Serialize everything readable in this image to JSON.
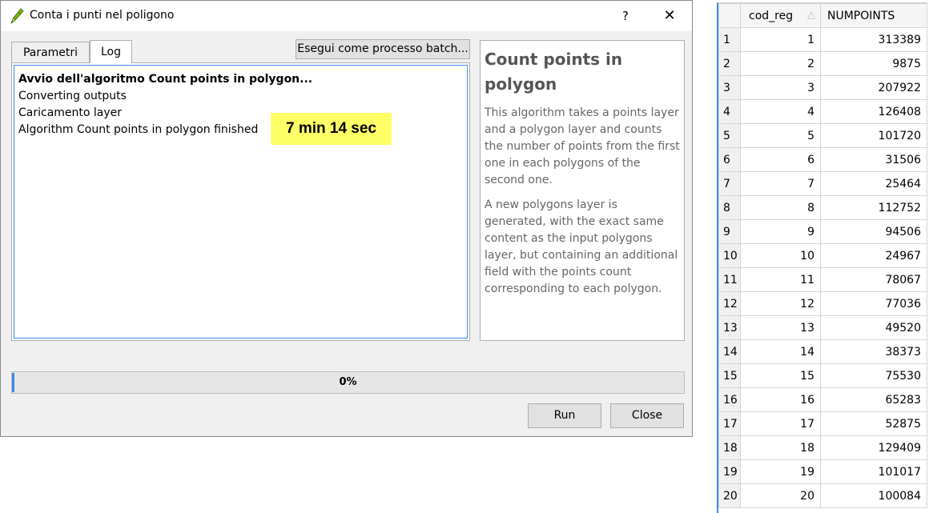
{
  "dialog": {
    "title": "Conta i punti nel poligono",
    "help_label": "?",
    "close_label": "✕",
    "tabs": [
      {
        "label": "Parametri",
        "active": false
      },
      {
        "label": "Log",
        "active": true
      }
    ],
    "batch_button": "Esegui come processo batch...",
    "log_lines": [
      "Avvio dell'algoritmo Count points in polygon...",
      "Converting outputs",
      "Caricamento layer",
      "Algorithm Count points in polygon finished"
    ],
    "time_badge": "7 min 14 sec",
    "help_title": "Count points in polygon",
    "help_paragraphs": [
      "This algorithm takes a points layer and a polygon layer and counts the number of points from the first one in each polygons of the second one.",
      "A new polygons layer is generated, with the exact same content as the input polygons layer, but containing an additional field with the points count corresponding to each polygon."
    ],
    "progress": {
      "text": "0%",
      "value": 0
    },
    "run_button": "Run",
    "close_button": "Close"
  },
  "table": {
    "columns": [
      "cod_reg",
      "NUMPOINTS"
    ],
    "sort_indicator": "△",
    "rows": [
      {
        "row": "1",
        "cod_reg": "1",
        "numpoints": "313389"
      },
      {
        "row": "2",
        "cod_reg": "2",
        "numpoints": "9875"
      },
      {
        "row": "3",
        "cod_reg": "3",
        "numpoints": "207922"
      },
      {
        "row": "4",
        "cod_reg": "4",
        "numpoints": "126408"
      },
      {
        "row": "5",
        "cod_reg": "5",
        "numpoints": "101720"
      },
      {
        "row": "6",
        "cod_reg": "6",
        "numpoints": "31506"
      },
      {
        "row": "7",
        "cod_reg": "7",
        "numpoints": "25464"
      },
      {
        "row": "8",
        "cod_reg": "8",
        "numpoints": "112752"
      },
      {
        "row": "9",
        "cod_reg": "9",
        "numpoints": "94506"
      },
      {
        "row": "10",
        "cod_reg": "10",
        "numpoints": "24967"
      },
      {
        "row": "11",
        "cod_reg": "11",
        "numpoints": "78067"
      },
      {
        "row": "12",
        "cod_reg": "12",
        "numpoints": "77036"
      },
      {
        "row": "13",
        "cod_reg": "13",
        "numpoints": "49520"
      },
      {
        "row": "14",
        "cod_reg": "14",
        "numpoints": "38373"
      },
      {
        "row": "15",
        "cod_reg": "15",
        "numpoints": "75530"
      },
      {
        "row": "16",
        "cod_reg": "16",
        "numpoints": "65283"
      },
      {
        "row": "17",
        "cod_reg": "17",
        "numpoints": "52875"
      },
      {
        "row": "18",
        "cod_reg": "18",
        "numpoints": "129409"
      },
      {
        "row": "19",
        "cod_reg": "19",
        "numpoints": "101017"
      },
      {
        "row": "20",
        "cod_reg": "20",
        "numpoints": "100084"
      }
    ]
  },
  "colors": {
    "time_badge_bg": "#ffff66",
    "focus_border": "#3c8be6",
    "app_icon": "#7ab317"
  },
  "icons": {
    "app": "qgis-pen-icon"
  }
}
